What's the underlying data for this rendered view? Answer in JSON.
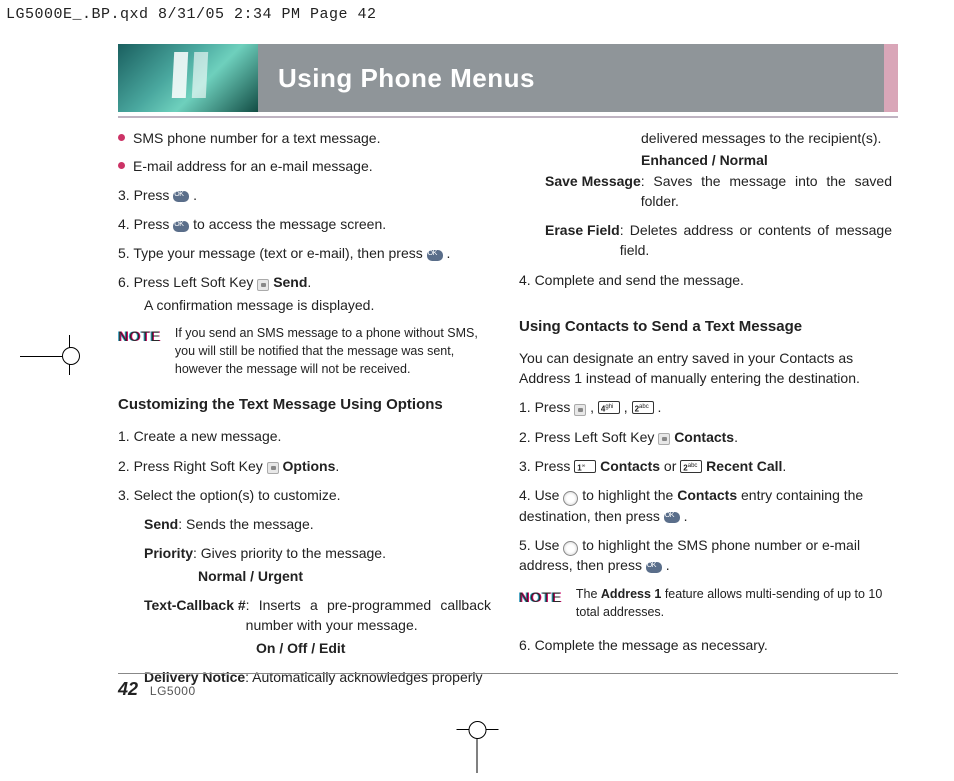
{
  "print_header": "LG5000E_.BP.qxd  8/31/05  2:34 PM  Page 42",
  "hero_title": "Using Phone Menus",
  "left": {
    "b1": "SMS phone number for a text message.",
    "b2": "E-mail address for an e-mail message.",
    "s3a": "3.  Press ",
    "s3b": " .",
    "s4a": "4.  Press ",
    "s4b": " to access the message screen.",
    "s5a": "5.  Type your message (text or e-mail), then press ",
    "s5b": " .",
    "s6a": "6.  Press Left Soft Key ",
    "s6b": "Send",
    "s6c": ".",
    "s6d": "A confirmation message is displayed.",
    "note_lbl": "NOTE",
    "note1": "If you send an SMS message to a phone without SMS, you will still be notified that the message was sent, however the message will not be received.",
    "sub1": "Customizing the Text Message Using Options",
    "c1": "1.  Create a new message.",
    "c2a": "2.  Press Right Soft Key  ",
    "c2b": "Options",
    "c2c": ".",
    "c3": "3.  Select the option(s) to customize.",
    "opt_send_l": "Send",
    "opt_send_b": ": Sends the message.",
    "opt_pri_l": "Priority",
    "opt_pri_b": ": Gives priority to the message.",
    "opt_pri_v": "Normal / Urgent",
    "opt_cb_l": "Text-Callback #",
    "opt_cb_b": ":  Inserts a pre-programmed callback number with your message.",
    "opt_cb_v": "On / Off / Edit",
    "opt_dn_l": "Delivery Notice",
    "opt_dn_b": ": Automatically acknowledges properly"
  },
  "right": {
    "cont1": "delivered messages to the recipient(s).",
    "cont1v": "Enhanced / Normal",
    "sm_l": "Save Message",
    "sm_b": ": Saves the message into the saved folder.",
    "ef_l": "Erase Field",
    "ef_b": ": Deletes address or contents of message field.",
    "s4": "4.  Complete and send the message.",
    "sub2": "Using Contacts to Send a Text Message",
    "intro": "You can designate an entry saved in your Contacts as Address 1 instead of manually entering the destination.",
    "u1a": "1.  Press  ",
    "u1b": " ,  ",
    "u1c": " ,  ",
    "u1d": " .",
    "u2a": "2.  Press Left Soft Key  ",
    "u2b": "Contacts",
    "u2c": ".",
    "u3a": "3.  Press ",
    "u3b": "Contacts",
    "u3c": " or  ",
    "u3d": "Recent Call",
    "u3e": ".",
    "u4a": "4.  Use ",
    "u4b": "  to highlight the ",
    "u4c": "Contacts",
    "u4d": " entry containing the destination, then press  ",
    "u4e": " .",
    "u5a": "5.  Use ",
    "u5b": "  to highlight the SMS phone number or e-mail address, then press  ",
    "u5c": " .",
    "note_lbl": "NOTE",
    "note2a": "The ",
    "note2b": "Address 1",
    "note2c": " feature allows multi-sending of up to 10 total addresses.",
    "u6": "6.  Complete the message as necessary."
  },
  "footer_page": "42",
  "footer_model": "LG5000"
}
